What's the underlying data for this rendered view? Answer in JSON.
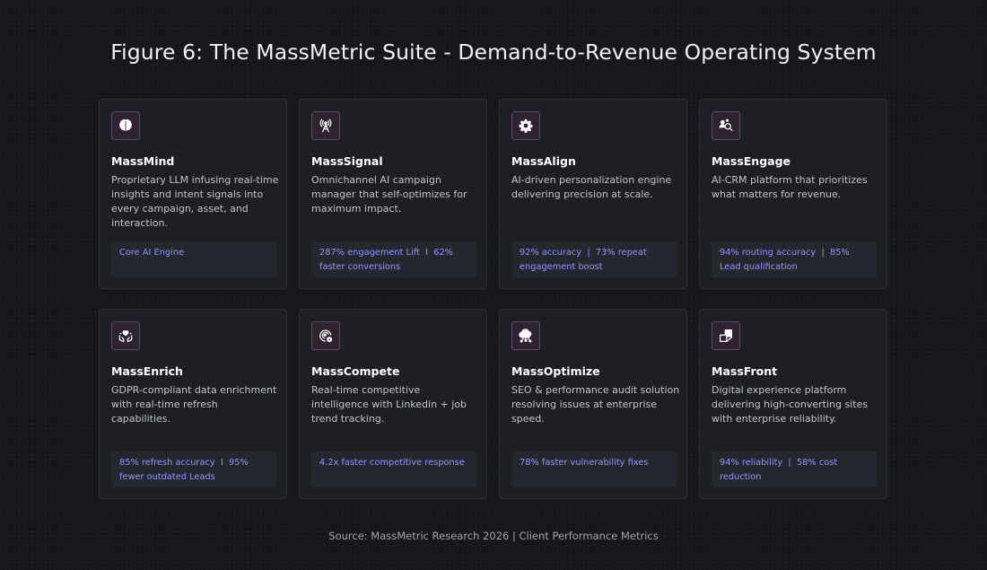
{
  "title": "Figure 6: The MassMetric Suite - Demand-to-Revenue Operating System",
  "source": "Source: MassMetric Research 2026 | Client Performance Metrics",
  "cards": [
    {
      "name": "MassMind",
      "icon": "brain-icon",
      "description": "Proprietary LLM infusing real-time insights and intent signals into every campaign, asset, and interaction.",
      "metric": "Core AI Engine"
    },
    {
      "name": "MassSignal",
      "icon": "signal-tower-icon",
      "description": "Omnichannel AI campaign manager that self-optimizes for maximum impact.",
      "metric": "287% engagement Lift  I  62% faster conversions"
    },
    {
      "name": "MassAlign",
      "icon": "gear-icon",
      "description": "AI-driven personalization engine delivering precision at scale.",
      "metric": "92% accuracy  |  73% repeat engagement boost"
    },
    {
      "name": "MassEngage",
      "icon": "user-search-icon",
      "description": "AI-CRM platform that prioritizes what matters for revenue.",
      "metric": "94% routing accuracy  |  85% Lead qualification"
    },
    {
      "name": "MassEnrich",
      "icon": "hands-care-icon",
      "description": "GDPR-compliant data enrichment with real-time refresh capabilities.",
      "metric": "85% refresh accuracy  I  95% fewer outdated Leads"
    },
    {
      "name": "MassCompete",
      "icon": "target-gear-icon",
      "description": "Real-time competitive intelligence with Linkedin + job trend tracking.",
      "metric": "4.2x faster competitive response"
    },
    {
      "name": "MassOptimize",
      "icon": "cloud-network-icon",
      "description": "SEO & performance audit solution resolving issues at enterprise speed.",
      "metric": "78% faster vulnerability fixes"
    },
    {
      "name": "MassFront",
      "icon": "layout-frame-icon",
      "description": "Digital experience platform delivering high-converting sites with enterprise reliability.",
      "metric": "94% reliability  |  58% cost reduction"
    }
  ]
}
